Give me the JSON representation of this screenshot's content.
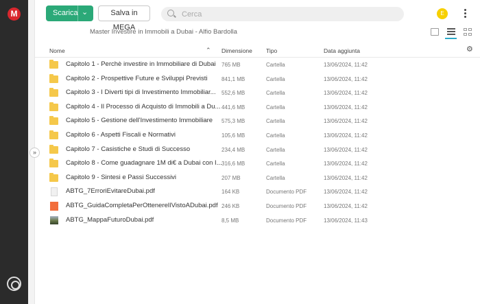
{
  "app": {
    "logo": "M"
  },
  "toolbar": {
    "download_label": "Scarica",
    "save_label": "Salva in MEGA",
    "search_placeholder": "Cerca",
    "avatar_letter": "E"
  },
  "breadcrumb": "Master Investire in Immobili a Dubai - Alfio Bardolla",
  "table": {
    "columns": {
      "name": "Nome",
      "size": "Dimensione",
      "type": "Tipo",
      "date": "Data aggiunta"
    },
    "rows": [
      {
        "icon": "folder-icon",
        "name": "Capitolo 1 - Perchè investire in Immobiliare di Dubai",
        "size": "765 MB",
        "type": "Cartella",
        "date": "13/06/2024, 11:42"
      },
      {
        "icon": "folder-icon",
        "name": "Capitolo 2 - Prospettive Future e Sviluppi Previsti",
        "size": "841,1 MB",
        "type": "Cartella",
        "date": "13/06/2024, 11:42"
      },
      {
        "icon": "folder-icon",
        "name": "Capitolo 3 - I Diverti tipi di Investimento Immobiliar...",
        "size": "552,6 MB",
        "type": "Cartella",
        "date": "13/06/2024, 11:42"
      },
      {
        "icon": "folder-icon",
        "name": "Capitolo 4 - Il Processo di Acquisto di Immobili a Du...",
        "size": "441,6 MB",
        "type": "Cartella",
        "date": "13/06/2024, 11:42"
      },
      {
        "icon": "folder-icon",
        "name": "Capitolo 5 - Gestione dell'Investimento Immobiliare",
        "size": "575,3 MB",
        "type": "Cartella",
        "date": "13/06/2024, 11:42"
      },
      {
        "icon": "folder-icon",
        "name": "Capitolo 6 - Aspetti Fiscali e Normativi",
        "size": "105,6 MB",
        "type": "Cartella",
        "date": "13/06/2024, 11:42"
      },
      {
        "icon": "folder-icon",
        "name": "Capitolo 7 - Casistiche e Studi di Successo",
        "size": "234,4 MB",
        "type": "Cartella",
        "date": "13/06/2024, 11:42"
      },
      {
        "icon": "folder-icon",
        "name": "Capitolo 8 - Come guadagnare 1M di€ a Dubai con I...",
        "size": "316,6 MB",
        "type": "Cartella",
        "date": "13/06/2024, 11:42"
      },
      {
        "icon": "folder-icon",
        "name": "Capitolo 9 - Sintesi e Passi Successivi",
        "size": "207 MB",
        "type": "Cartella",
        "date": "13/06/2024, 11:42"
      },
      {
        "icon": "pdf-file-icon",
        "name": "ABTG_7ErroriEvitareDubai.pdf",
        "size": "164 KB",
        "type": "Documento PDF",
        "date": "13/06/2024, 11:42"
      },
      {
        "icon": "pdf-thumbnail-icon",
        "name": "ABTG_GuidaCompletaPerOttenerelIVistoADubai.pdf",
        "size": "246 KB",
        "type": "Documento PDF",
        "date": "13/06/2024, 11:42"
      },
      {
        "icon": "image-thumbnail-icon",
        "name": "ABTG_MappaFuturoDubai.pdf",
        "size": "8,5 MB",
        "type": "Documento PDF",
        "date": "13/06/2024, 11:43"
      }
    ]
  },
  "colors": {
    "accent_green": "#2ba978",
    "brand_red": "#d9272e",
    "folder_yellow": "#f5c84a",
    "avatar_yellow": "#f7d000"
  }
}
